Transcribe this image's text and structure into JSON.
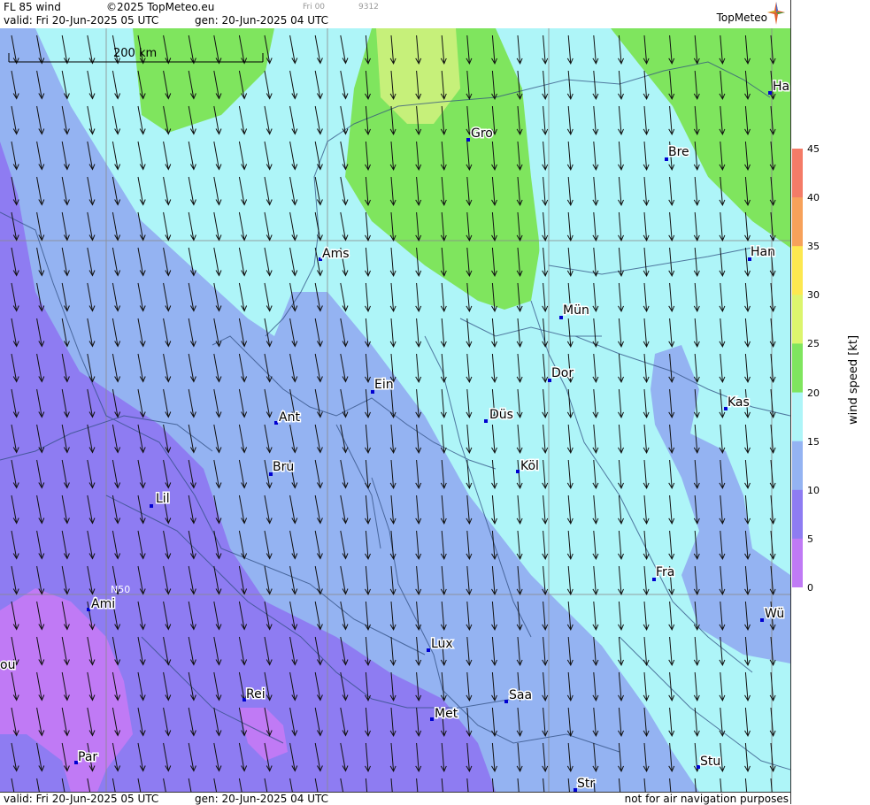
{
  "header": {
    "title": "FL 85 wind",
    "copyright": "©2025 TopMeteo.eu",
    "valid": "valid:  Fri  20-Jun-2025  05 UTC",
    "gen": "gen: 20-Jun-2025 04 UTC",
    "faint_day": "Fri 00",
    "faint_code": "9312",
    "logo": "TopMeteo"
  },
  "footer": {
    "valid": "valid:  Fri  20-Jun-2025  05 UTC",
    "gen": "gen: 20-Jun-2025 04 UTC",
    "note": "not for air navigation purposes"
  },
  "map": {
    "scale_label": "200 km",
    "lat_label": "N50",
    "cities": [
      {
        "name": "Ha"
      },
      {
        "name": "Gro"
      },
      {
        "name": "Bre"
      },
      {
        "name": "Ams"
      },
      {
        "name": "Han"
      },
      {
        "name": "Mün"
      },
      {
        "name": "Dor"
      },
      {
        "name": "Ein"
      },
      {
        "name": "Kas"
      },
      {
        "name": "Ant"
      },
      {
        "name": "Düs"
      },
      {
        "name": "Köl"
      },
      {
        "name": "Bru"
      },
      {
        "name": "Lil"
      },
      {
        "name": "Fra"
      },
      {
        "name": "Ami"
      },
      {
        "name": "Wü"
      },
      {
        "name": "Lux"
      },
      {
        "name": "ou"
      },
      {
        "name": "Rei"
      },
      {
        "name": "Saa"
      },
      {
        "name": "Met"
      },
      {
        "name": "Stu"
      },
      {
        "name": "Par"
      },
      {
        "name": "Str"
      }
    ],
    "band_colors": [
      "#c07af5",
      "#8e7cf2",
      "#94b3f2",
      "#aef5f8",
      "#7fe55e",
      "#c6f07a"
    ]
  },
  "legend": {
    "label": "wind  speed  [kt]",
    "ticks": [
      "45",
      "40",
      "35",
      "30",
      "25",
      "20",
      "15",
      "10",
      "5",
      "0"
    ],
    "colors": [
      "#f47b67",
      "#f7a15a",
      "#fde84f",
      "#dcf56d",
      "#7fe55e",
      "#aef5f8",
      "#94b3f2",
      "#8e7cf2",
      "#c07af5"
    ]
  }
}
